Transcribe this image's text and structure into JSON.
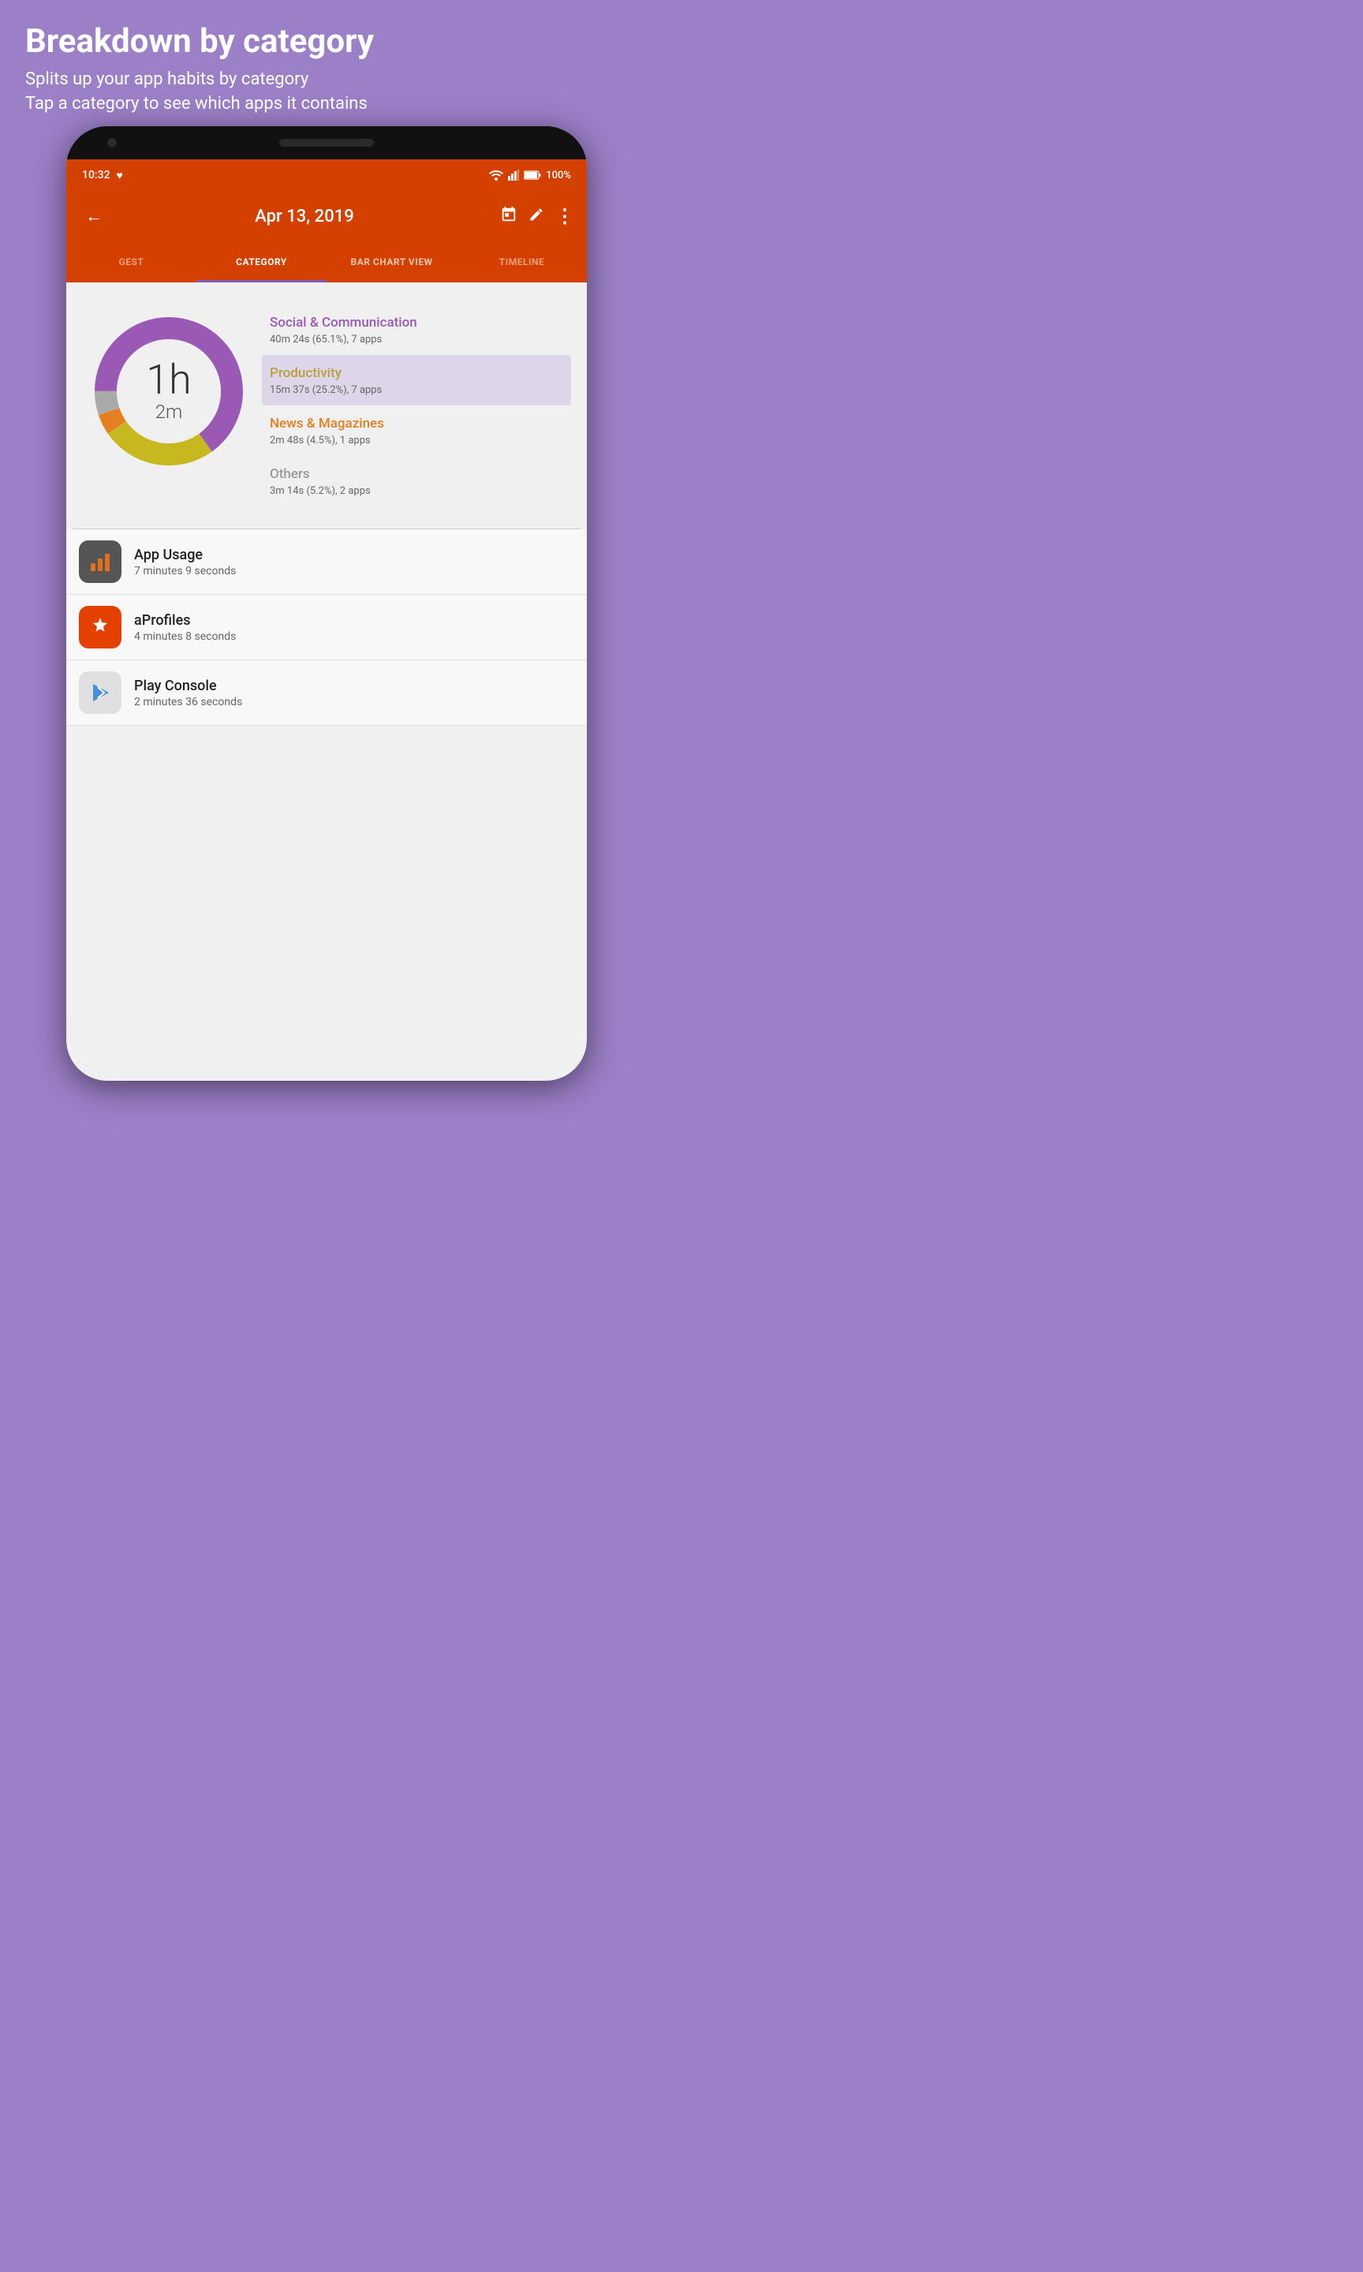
{
  "page": {
    "background_color": "#9b7fc7",
    "title": "Breakdown by category",
    "subtitle_line1": "Splits up your app habits by category",
    "subtitle_line2": "Tap a category to see which apps it contains"
  },
  "status_bar": {
    "time": "10:32",
    "battery": "100%",
    "heart_icon": "♥"
  },
  "app_bar": {
    "back_icon": "←",
    "date": "Apr 13, 2019",
    "calendar_icon": "📅",
    "edit_icon": "✏",
    "more_icon": "⋮"
  },
  "tabs": [
    {
      "label": "GEST",
      "active": false,
      "partial": true
    },
    {
      "label": "CATEGORY",
      "active": true,
      "partial": false
    },
    {
      "label": "BAR CHART VIEW",
      "active": false,
      "partial": false
    },
    {
      "label": "TIMELINE",
      "active": false,
      "partial": true
    }
  ],
  "donut": {
    "center_time_big": "1h",
    "center_time_sub": "2m",
    "segments": [
      {
        "color": "#9b59b6",
        "percent": 65.1,
        "label": "Social & Communication"
      },
      {
        "color": "#c8b820",
        "percent": 25.2,
        "label": "Productivity"
      },
      {
        "color": "#e67e22",
        "percent": 4.5,
        "label": "News & Magazines"
      },
      {
        "color": "#aaa",
        "percent": 5.2,
        "label": "Others"
      }
    ]
  },
  "categories": [
    {
      "name": "Social & Communication",
      "stats": "40m 24s (65.1%), 7 apps",
      "color_class": "color-social",
      "highlighted": false
    },
    {
      "name": "Productivity",
      "stats": "15m 37s (25.2%), 7 apps",
      "color_class": "color-productivity",
      "highlighted": true
    },
    {
      "name": "News & Magazines",
      "stats": "2m 48s (4.5%), 1 apps",
      "color_class": "color-news",
      "highlighted": false
    },
    {
      "name": "Others",
      "stats": "3m 14s (5.2%), 2 apps",
      "color_class": "color-others",
      "highlighted": false
    }
  ],
  "apps": [
    {
      "name": "App Usage",
      "time": "7 minutes 9 seconds",
      "icon_type": "usage",
      "icon_emoji": "📊"
    },
    {
      "name": "aProfiles",
      "time": "4 minutes 8 seconds",
      "icon_type": "aprofiles",
      "icon_emoji": "⚙"
    },
    {
      "name": "Play Console",
      "time": "2 minutes 36 seconds",
      "icon_type": "playconsole",
      "icon_emoji": "📈"
    }
  ]
}
